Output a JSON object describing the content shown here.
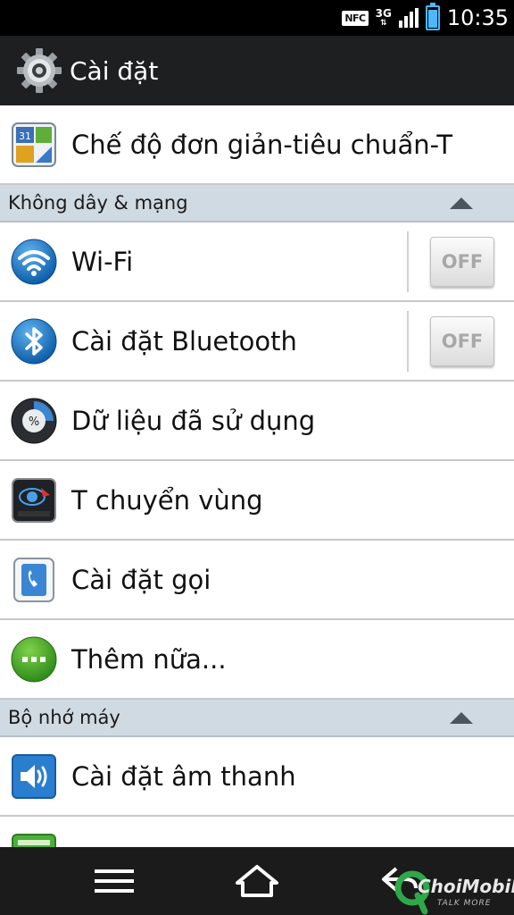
{
  "status_bar": {
    "nfc": "NFC",
    "network": "3G",
    "network_arrows": "⇅",
    "time": "10:35",
    "battery_level": 0.85
  },
  "action_bar": {
    "title": "Cài đặt",
    "icon": "settings-gear-icon"
  },
  "items": [
    {
      "label": "Chế độ đơn giản-tiêu chuẩn-T",
      "icon": "calendar-app-icon"
    },
    {
      "label": "Wi-Fi",
      "icon": "wifi-icon",
      "toggle": "OFF"
    },
    {
      "label": "Cài đặt Bluetooth",
      "icon": "bluetooth-icon",
      "toggle": "OFF"
    },
    {
      "label": "Dữ liệu đã sử dụng",
      "icon": "data-usage-icon"
    },
    {
      "label": "T chuyển vùng",
      "icon": "roaming-icon"
    },
    {
      "label": "Cài đặt gọi",
      "icon": "phone-call-icon"
    },
    {
      "label": "Thêm nữa...",
      "icon": "more-dots-icon"
    },
    {
      "label": "Cài đặt âm thanh",
      "icon": "speaker-icon"
    }
  ],
  "sections": {
    "wireless": "Không dây & mạng",
    "device": "Bộ nhớ máy"
  },
  "nav_bar": {
    "icons": [
      "menu-icon",
      "home-icon",
      "back-icon"
    ]
  },
  "watermark": {
    "text": "ChoiMobile",
    "sub": "TALK MORE"
  },
  "colors": {
    "status_bar": "#000000",
    "action_bar": "#1d1f21",
    "section_header": "#d0dae3",
    "nav_bar": "#1b1b1b"
  }
}
